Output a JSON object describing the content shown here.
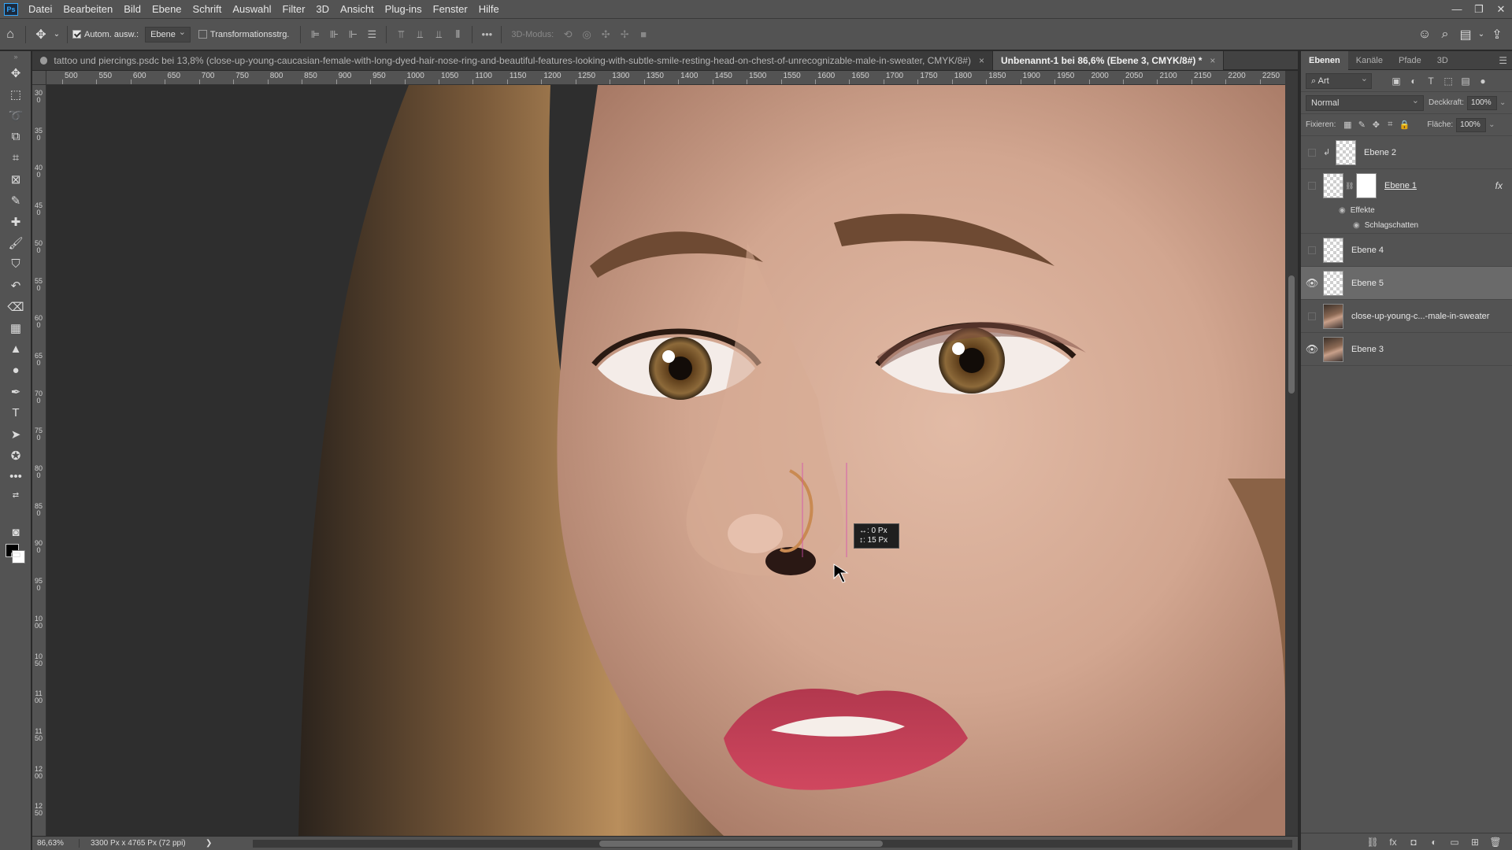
{
  "menu": {
    "logo": "Ps",
    "items": [
      "Datei",
      "Bearbeiten",
      "Bild",
      "Ebene",
      "Schrift",
      "Auswahl",
      "Filter",
      "3D",
      "Ansicht",
      "Plug-ins",
      "Fenster",
      "Hilfe"
    ]
  },
  "options": {
    "auto_select_label": "Autom. ausw.:",
    "auto_select_target": "Ebene",
    "transform_label": "Transformationsstrg.",
    "mode3d_label": "3D-Modus:"
  },
  "tabs": [
    {
      "title": "tattoo und piercings.psdc bei 13,8% (close-up-young-caucasian-female-with-long-dyed-hair-nose-ring-and-beautiful-features-looking-with-subtle-smile-resting-head-on-chest-of-unrecognizable-male-in-sweater, CMYK/8#)",
      "close": "×"
    },
    {
      "title": "Unbenannt-1 bei 86,6% (Ebene 3, CMYK/8#) *",
      "close": "×"
    }
  ],
  "ruler": {
    "h_ticks": [
      "500",
      "550",
      "600",
      "650",
      "700",
      "750",
      "800",
      "850",
      "900",
      "950",
      "1000",
      "1050",
      "1100",
      "1150",
      "1200",
      "1250",
      "1300",
      "1350",
      "1400",
      "1450",
      "1500",
      "1550",
      "1600",
      "1650",
      "1700",
      "1750",
      "1800",
      "1850",
      "1900",
      "1950",
      "2000",
      "2050",
      "2100",
      "2150",
      "2200",
      "2250"
    ],
    "v_ticks": [
      "300",
      "350",
      "400",
      "450",
      "500",
      "550",
      "600",
      "650",
      "700",
      "750",
      "800",
      "850",
      "900",
      "950",
      "1000",
      "1050",
      "1100",
      "1150",
      "1200",
      "1250"
    ]
  },
  "hud": {
    "dx": "↔: 0 Px",
    "dy": "↕: 15 Px"
  },
  "status": {
    "zoom": "86,63%",
    "doc_info": "3300 Px x 4765 Px (72 ppi)",
    "arrow": "❯"
  },
  "panel": {
    "tabs": [
      "Ebenen",
      "Kanäle",
      "Pfade",
      "3D"
    ],
    "filter_kind": "Art",
    "blend_mode": "Normal",
    "opacity_label": "Deckkraft:",
    "opacity_value": "100%",
    "lock_label": "Fixieren:",
    "fill_label": "Fläche:",
    "fill_value": "100%",
    "layers": [
      {
        "name": "Ebene 2",
        "visible": false,
        "clipped": true
      },
      {
        "name": "Ebene 1",
        "visible": false,
        "fx": "fx",
        "effects_label": "Effekte",
        "effect": "Schlagschatten"
      },
      {
        "name": "Ebene 4",
        "visible": false
      },
      {
        "name": "Ebene 5",
        "visible": true,
        "selected": true
      },
      {
        "name": "close-up-young-c...-male-in-sweater",
        "visible": false
      },
      {
        "name": "Ebene 3",
        "visible": true
      }
    ]
  }
}
